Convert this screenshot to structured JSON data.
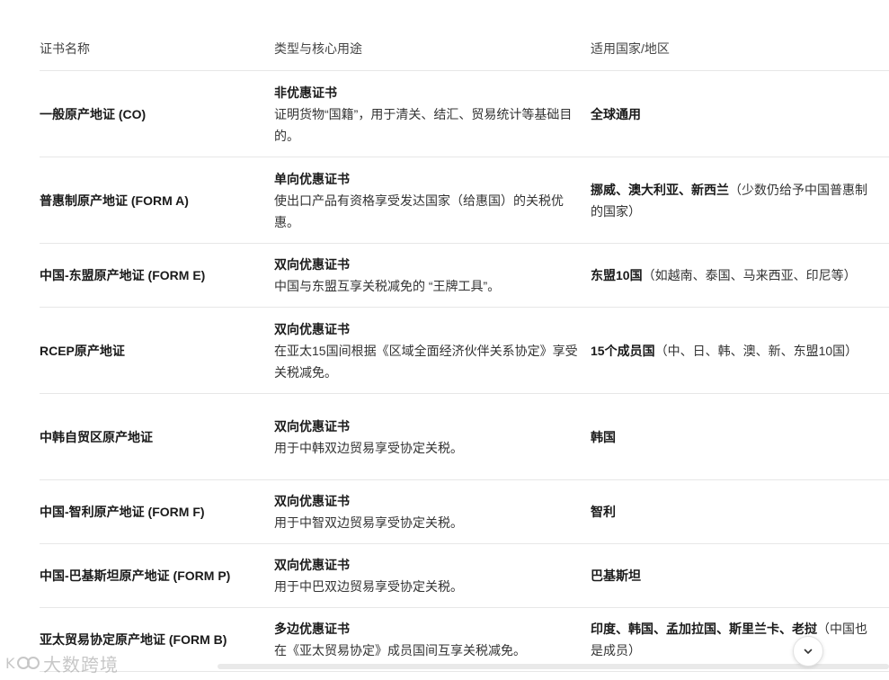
{
  "table": {
    "headers": [
      "证书名称",
      "类型与核心用途",
      "适用国家/地区"
    ],
    "rows": [
      {
        "name": "一般原产地证 (CO)",
        "type_title": "非优惠证书",
        "type_desc": "证明货物“国籍”，用于清关、结汇、贸易统计等基础目的。",
        "country_bold": "全球通用",
        "country_note": ""
      },
      {
        "name": "普惠制原产地证 (FORM A)",
        "type_title": "单向优惠证书",
        "type_desc": "使出口产品有资格享受发达国家（给惠国）的关税优惠。",
        "country_bold": "挪威、澳大利亚、新西兰",
        "country_note": "（少数仍给予中国普惠制的国家）"
      },
      {
        "name": "中国-东盟原产地证 (FORM E)",
        "type_title": "双向优惠证书",
        "type_desc": "中国与东盟互享关税减免的 “王牌工具”。",
        "country_bold": "东盟10国",
        "country_note": "（如越南、泰国、马来西亚、印尼等）"
      },
      {
        "name": "RCEP原产地证",
        "type_title": "双向优惠证书",
        "type_desc": "在亚太15国间根据《区域全面经济伙伴关系协定》享受关税减免。",
        "country_bold": "15个成员国",
        "country_note": "（中、日、韩、澳、新、东盟10国）"
      },
      {
        "name": "中韩自贸区原产地证",
        "type_title": "双向优惠证书",
        "type_desc": "用于中韩双边贸易享受协定关税。",
        "country_bold": "韩国",
        "country_note": ""
      },
      {
        "name": "中国-智利原产地证 (FORM F)",
        "type_title": "双向优惠证书",
        "type_desc": "用于中智双边贸易享受协定关税。",
        "country_bold": "智利",
        "country_note": ""
      },
      {
        "name": "中国-巴基斯坦原产地证 (FORM P)",
        "type_title": "双向优惠证书",
        "type_desc": "用于中巴双边贸易享受协定关税。",
        "country_bold": "巴基斯坦",
        "country_note": ""
      },
      {
        "name": "亚太贸易协定原产地证 (FORM B)",
        "type_title": "多边优惠证书",
        "type_desc": "在《亚太贸易协定》成员国间互享关税减免。",
        "country_bold": "印度、韩国、孟加拉国、斯里兰卡、老挝",
        "country_note": "（中国也是成员）"
      }
    ]
  },
  "watermark": {
    "text": "大数跨境"
  },
  "icons": {
    "scroll_down": "chevron-down-icon",
    "watermark_logo": "logo-icon"
  }
}
